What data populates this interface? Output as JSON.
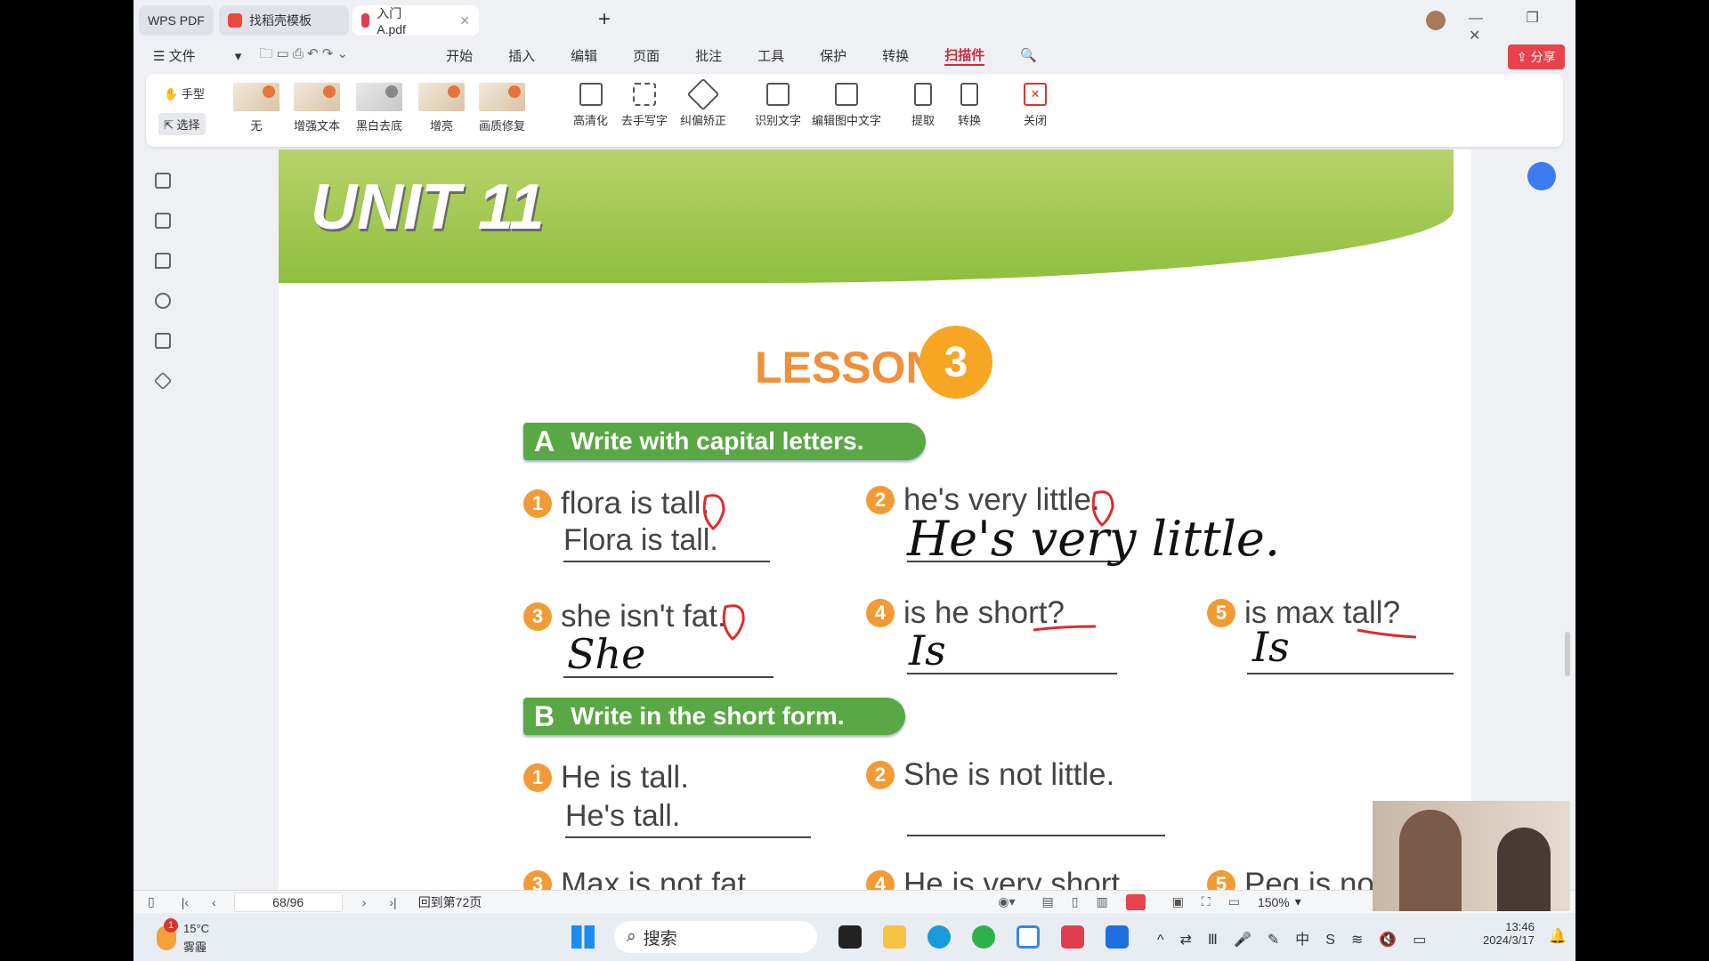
{
  "tabs": {
    "app": "WPS PDF",
    "template": "找稻壳模板",
    "doc": "入门A.pdf"
  },
  "menu": {
    "file": "文件",
    "items": [
      "开始",
      "插入",
      "编辑",
      "页面",
      "批注",
      "工具",
      "保护",
      "转换",
      "扫描件"
    ],
    "share": "分享"
  },
  "ribbon": {
    "hand": "手型",
    "select": "选择",
    "filters": [
      "无",
      "增强文本",
      "黑白去底",
      "增亮",
      "画质修复"
    ],
    "tools": [
      "高清化",
      "去手写字",
      "纠偏矫正",
      "识别文字",
      "编辑图中文字",
      "提取",
      "转换",
      "关闭"
    ]
  },
  "page": {
    "unit": "UNIT 11",
    "lesson": "LESSON",
    "lesson_num": "3",
    "secA": {
      "letter": "A",
      "title": "Write with capital letters.",
      "items": [
        {
          "n": "1",
          "q": "flora is tall.",
          "a": "Flora is tall.",
          "hw": ""
        },
        {
          "n": "2",
          "q": "he's very little.",
          "a": "",
          "hw": "He's very little."
        },
        {
          "n": "3",
          "q": "she isn't fat.",
          "a": "",
          "hw": "She"
        },
        {
          "n": "4",
          "q": "is he short?",
          "a": "",
          "hw": "Is"
        },
        {
          "n": "5",
          "q": "is max tall?",
          "a": "",
          "hw": "Is"
        }
      ]
    },
    "secB": {
      "letter": "B",
      "title": "Write in the short form.",
      "items": [
        {
          "n": "1",
          "q": "He is tall.",
          "a": "He's tall."
        },
        {
          "n": "2",
          "q": "She is not little.",
          "a": ""
        },
        {
          "n": "3",
          "q": "Max is not fat."
        },
        {
          "n": "4",
          "q": "He is very short."
        },
        {
          "n": "5",
          "q": "Peg is not tall."
        }
      ]
    }
  },
  "status": {
    "page": "68/96",
    "back": "回到第72页",
    "zoom": "150%"
  },
  "taskbar": {
    "temp": "15°C",
    "weather": "雾霾",
    "badge": "1",
    "search": "搜索",
    "time": "13:46",
    "date": "2024/3/17"
  }
}
